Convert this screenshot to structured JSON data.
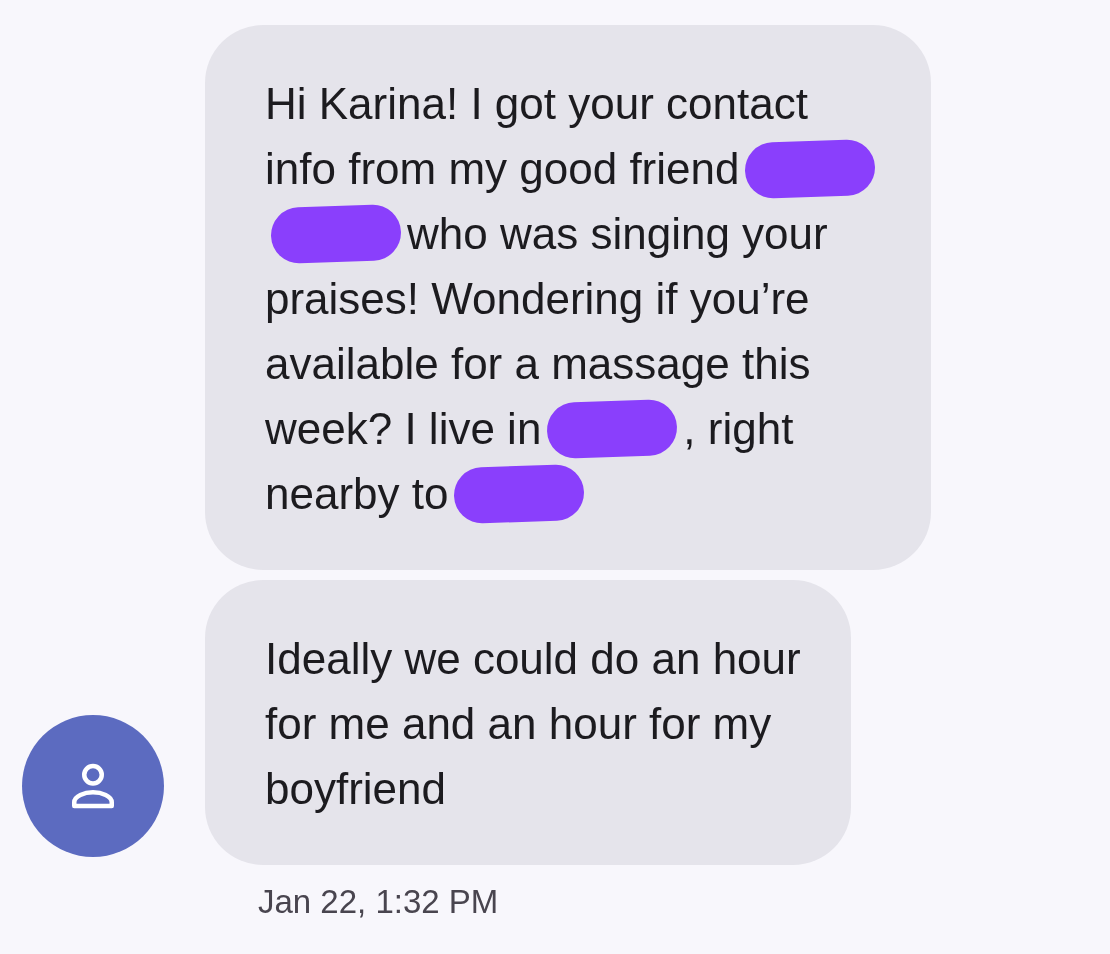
{
  "messages": [
    {
      "lines": [
        [
          {
            "kind": "text",
            "text": "Hi Karina! I got your contact"
          }
        ],
        [
          {
            "kind": "text",
            "text": "info from my good friend"
          },
          {
            "kind": "redaction"
          }
        ],
        [
          {
            "kind": "redaction"
          },
          {
            "kind": "text",
            "text": "who was singing your"
          }
        ],
        [
          {
            "kind": "text",
            "text": "praises! Wondering if you’re"
          }
        ],
        [
          {
            "kind": "text",
            "text": "available for a massage this"
          }
        ],
        [
          {
            "kind": "text",
            "text": "week? I live in"
          },
          {
            "kind": "redaction"
          },
          {
            "kind": "text",
            "text": ", right"
          }
        ],
        [
          {
            "kind": "text",
            "text": "nearby to"
          },
          {
            "kind": "redaction"
          }
        ]
      ]
    },
    {
      "lines": [
        [
          {
            "kind": "text",
            "text": "Ideally we could do an hour"
          }
        ],
        [
          {
            "kind": "text",
            "text": "for me and an hour for my"
          }
        ],
        [
          {
            "kind": "text",
            "text": "boyfriend"
          }
        ]
      ]
    }
  ],
  "timestamp": "Jan 22, 1:32 PM"
}
